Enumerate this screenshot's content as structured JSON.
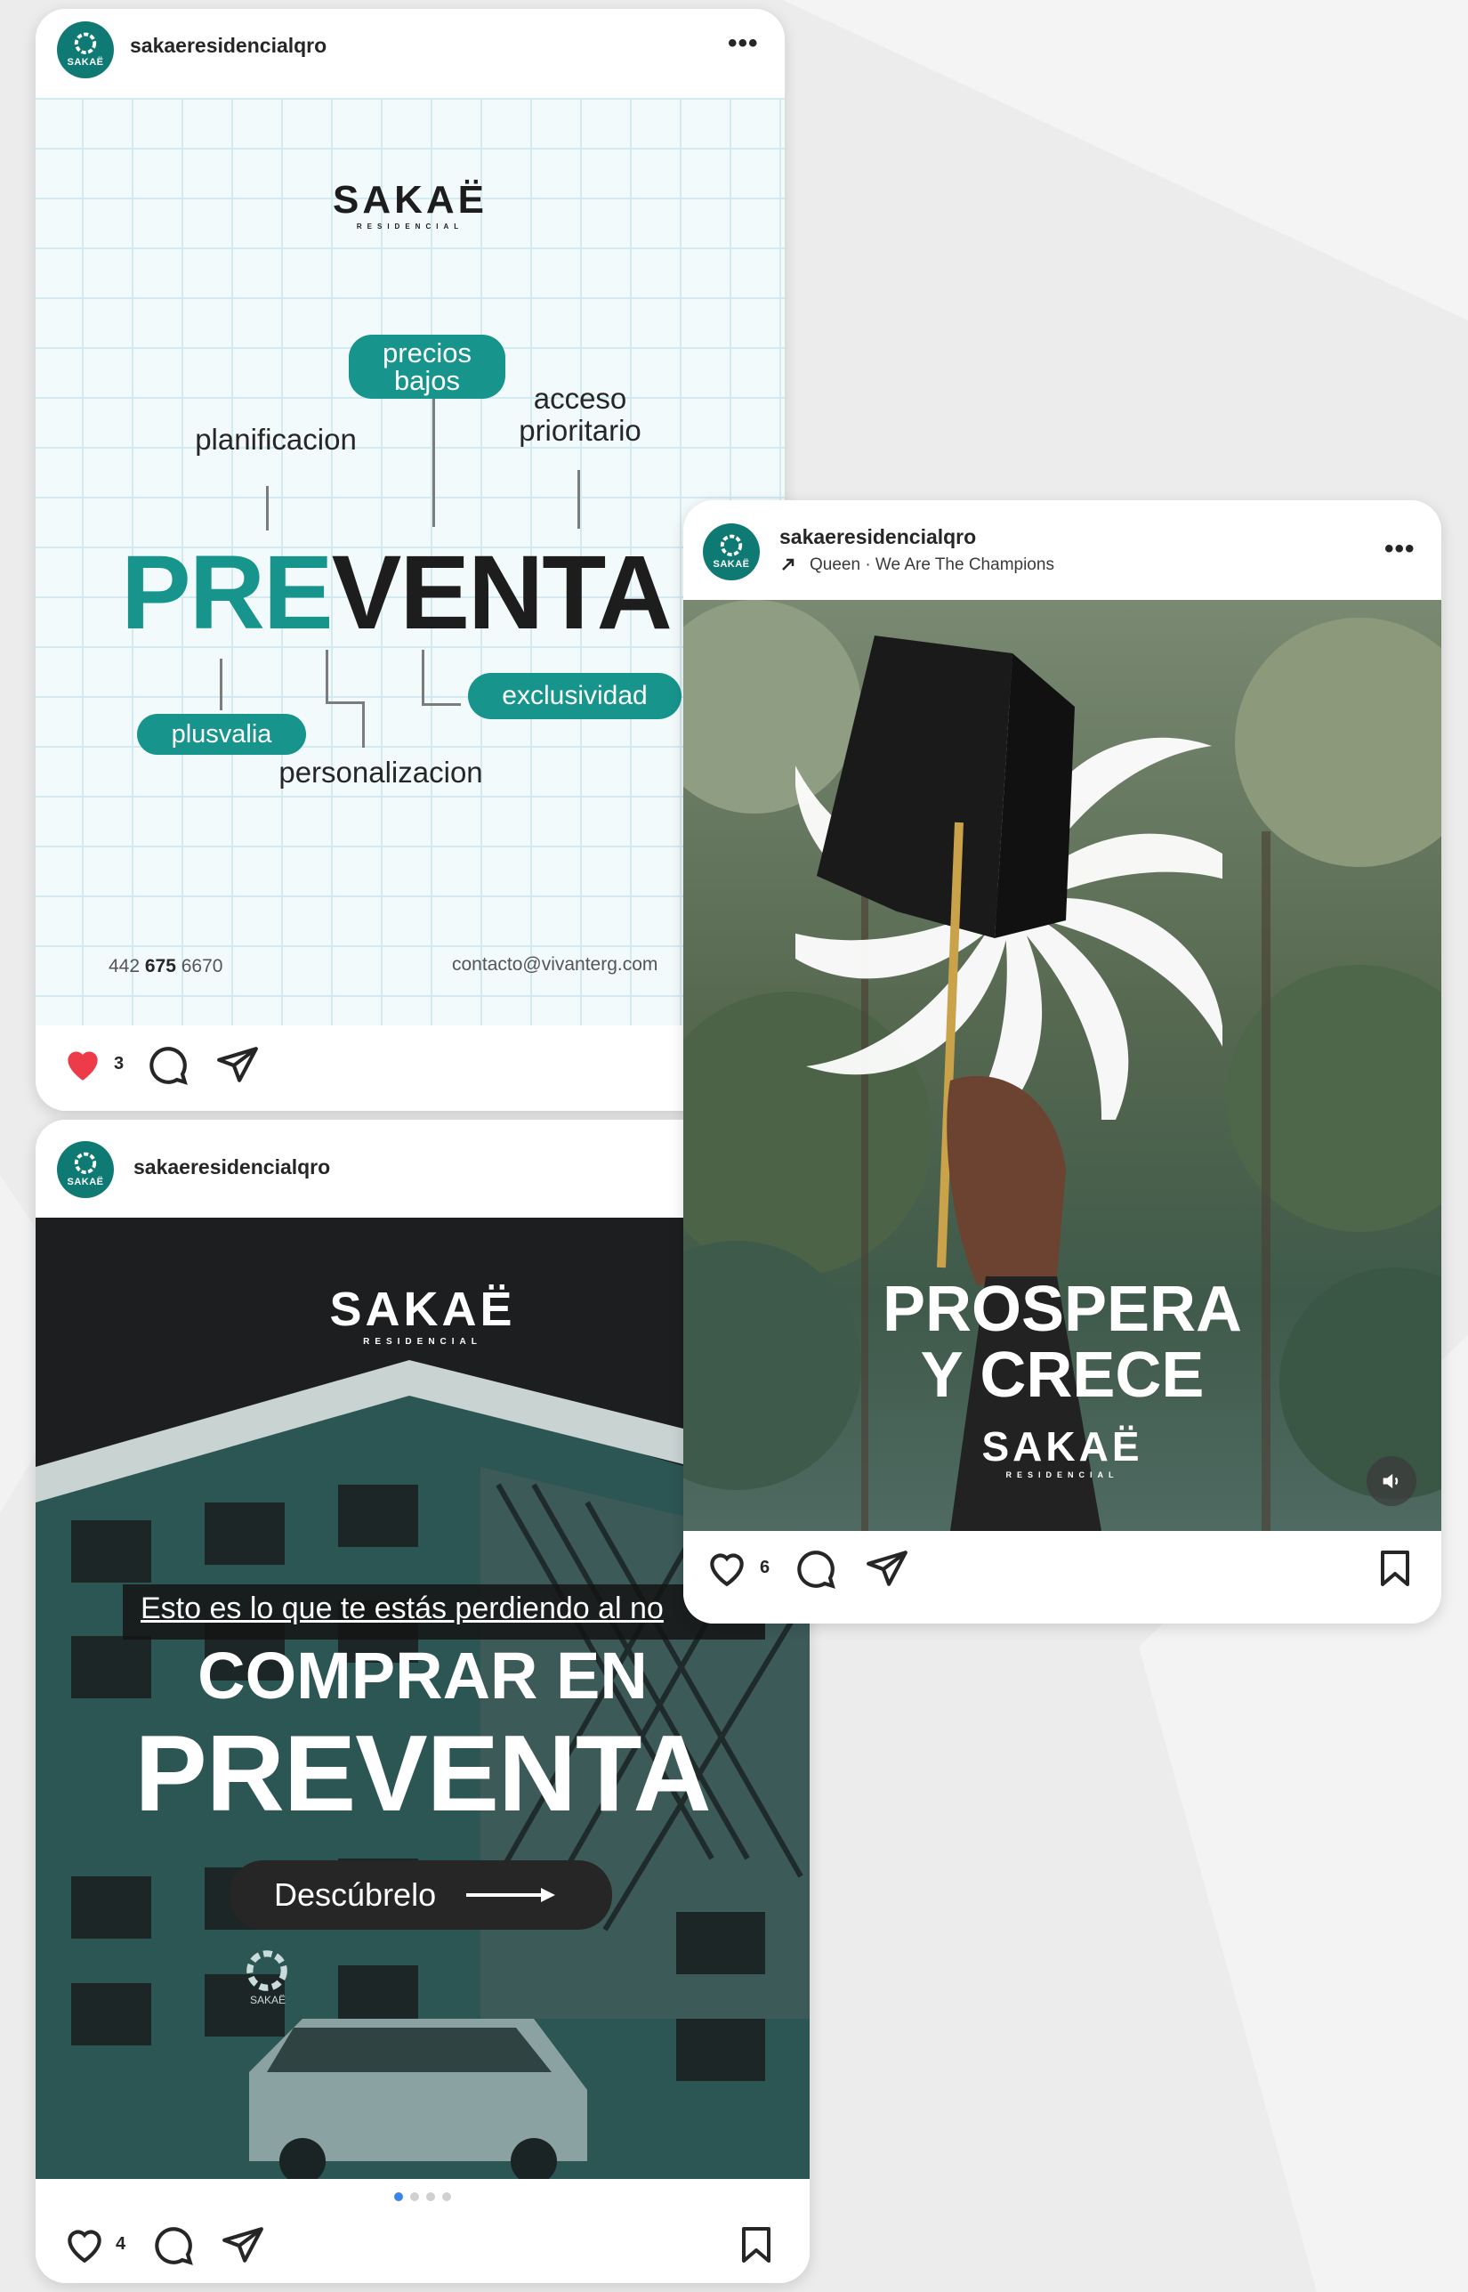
{
  "colors": {
    "teal": "#17948c",
    "dark_teal": "#0f7a74",
    "dark": "#1d1d1d",
    "like_red": "#ed3b4a",
    "text": "#262626",
    "active_dot": "#3a86e8"
  },
  "post1": {
    "username": "sakaeresidencialqro",
    "more_label": "•••",
    "brand": "SAKAË",
    "brand_sub": "RESIDENCIAL",
    "pill_precios": "precios bajos",
    "word_acceso": "acceso prioritario",
    "word_planificacion": "planificacion",
    "headline_part1": "PRE",
    "headline_part2": "VENTA",
    "pill_exclusividad": "exclusividad",
    "pill_plusvalia": "plusvalia",
    "word_personalizacion": "personalizacion",
    "phone_prefix": "442 ",
    "phone_bold": "675",
    "phone_suffix": " 6670",
    "email": "contacto@vivanterg.com",
    "likes": "3",
    "liked": true,
    "icons": [
      "heart-icon",
      "comment-icon",
      "share-icon",
      "more-icon"
    ]
  },
  "post2": {
    "username": "sakaeresidencialqro",
    "brand": "SAKAË",
    "brand_sub": "RESIDENCIAL",
    "overlay_line": "Esto es lo que te estás perdiendo al no",
    "headline_1": "COMPRAR EN",
    "headline_2": "PREVENTA",
    "cta_label": "Descúbrelo",
    "building_sign": "SAKAË",
    "likes": "4",
    "carousel_total": 4,
    "carousel_active": 1,
    "icons": [
      "heart-icon",
      "comment-icon",
      "share-icon",
      "bookmark-icon"
    ]
  },
  "post3": {
    "username": "sakaeresidencialqro",
    "music": "Queen · We Are The Champions",
    "more_label": "•••",
    "headline_1": "PROSPERA",
    "headline_2": "Y CRECE",
    "brand": "SAKAË",
    "brand_sub": "RESIDENCIAL",
    "likes": "6",
    "icons": [
      "heart-icon",
      "comment-icon",
      "share-icon",
      "bookmark-icon",
      "sound-icon"
    ]
  },
  "avatar_label": "SAKAË"
}
